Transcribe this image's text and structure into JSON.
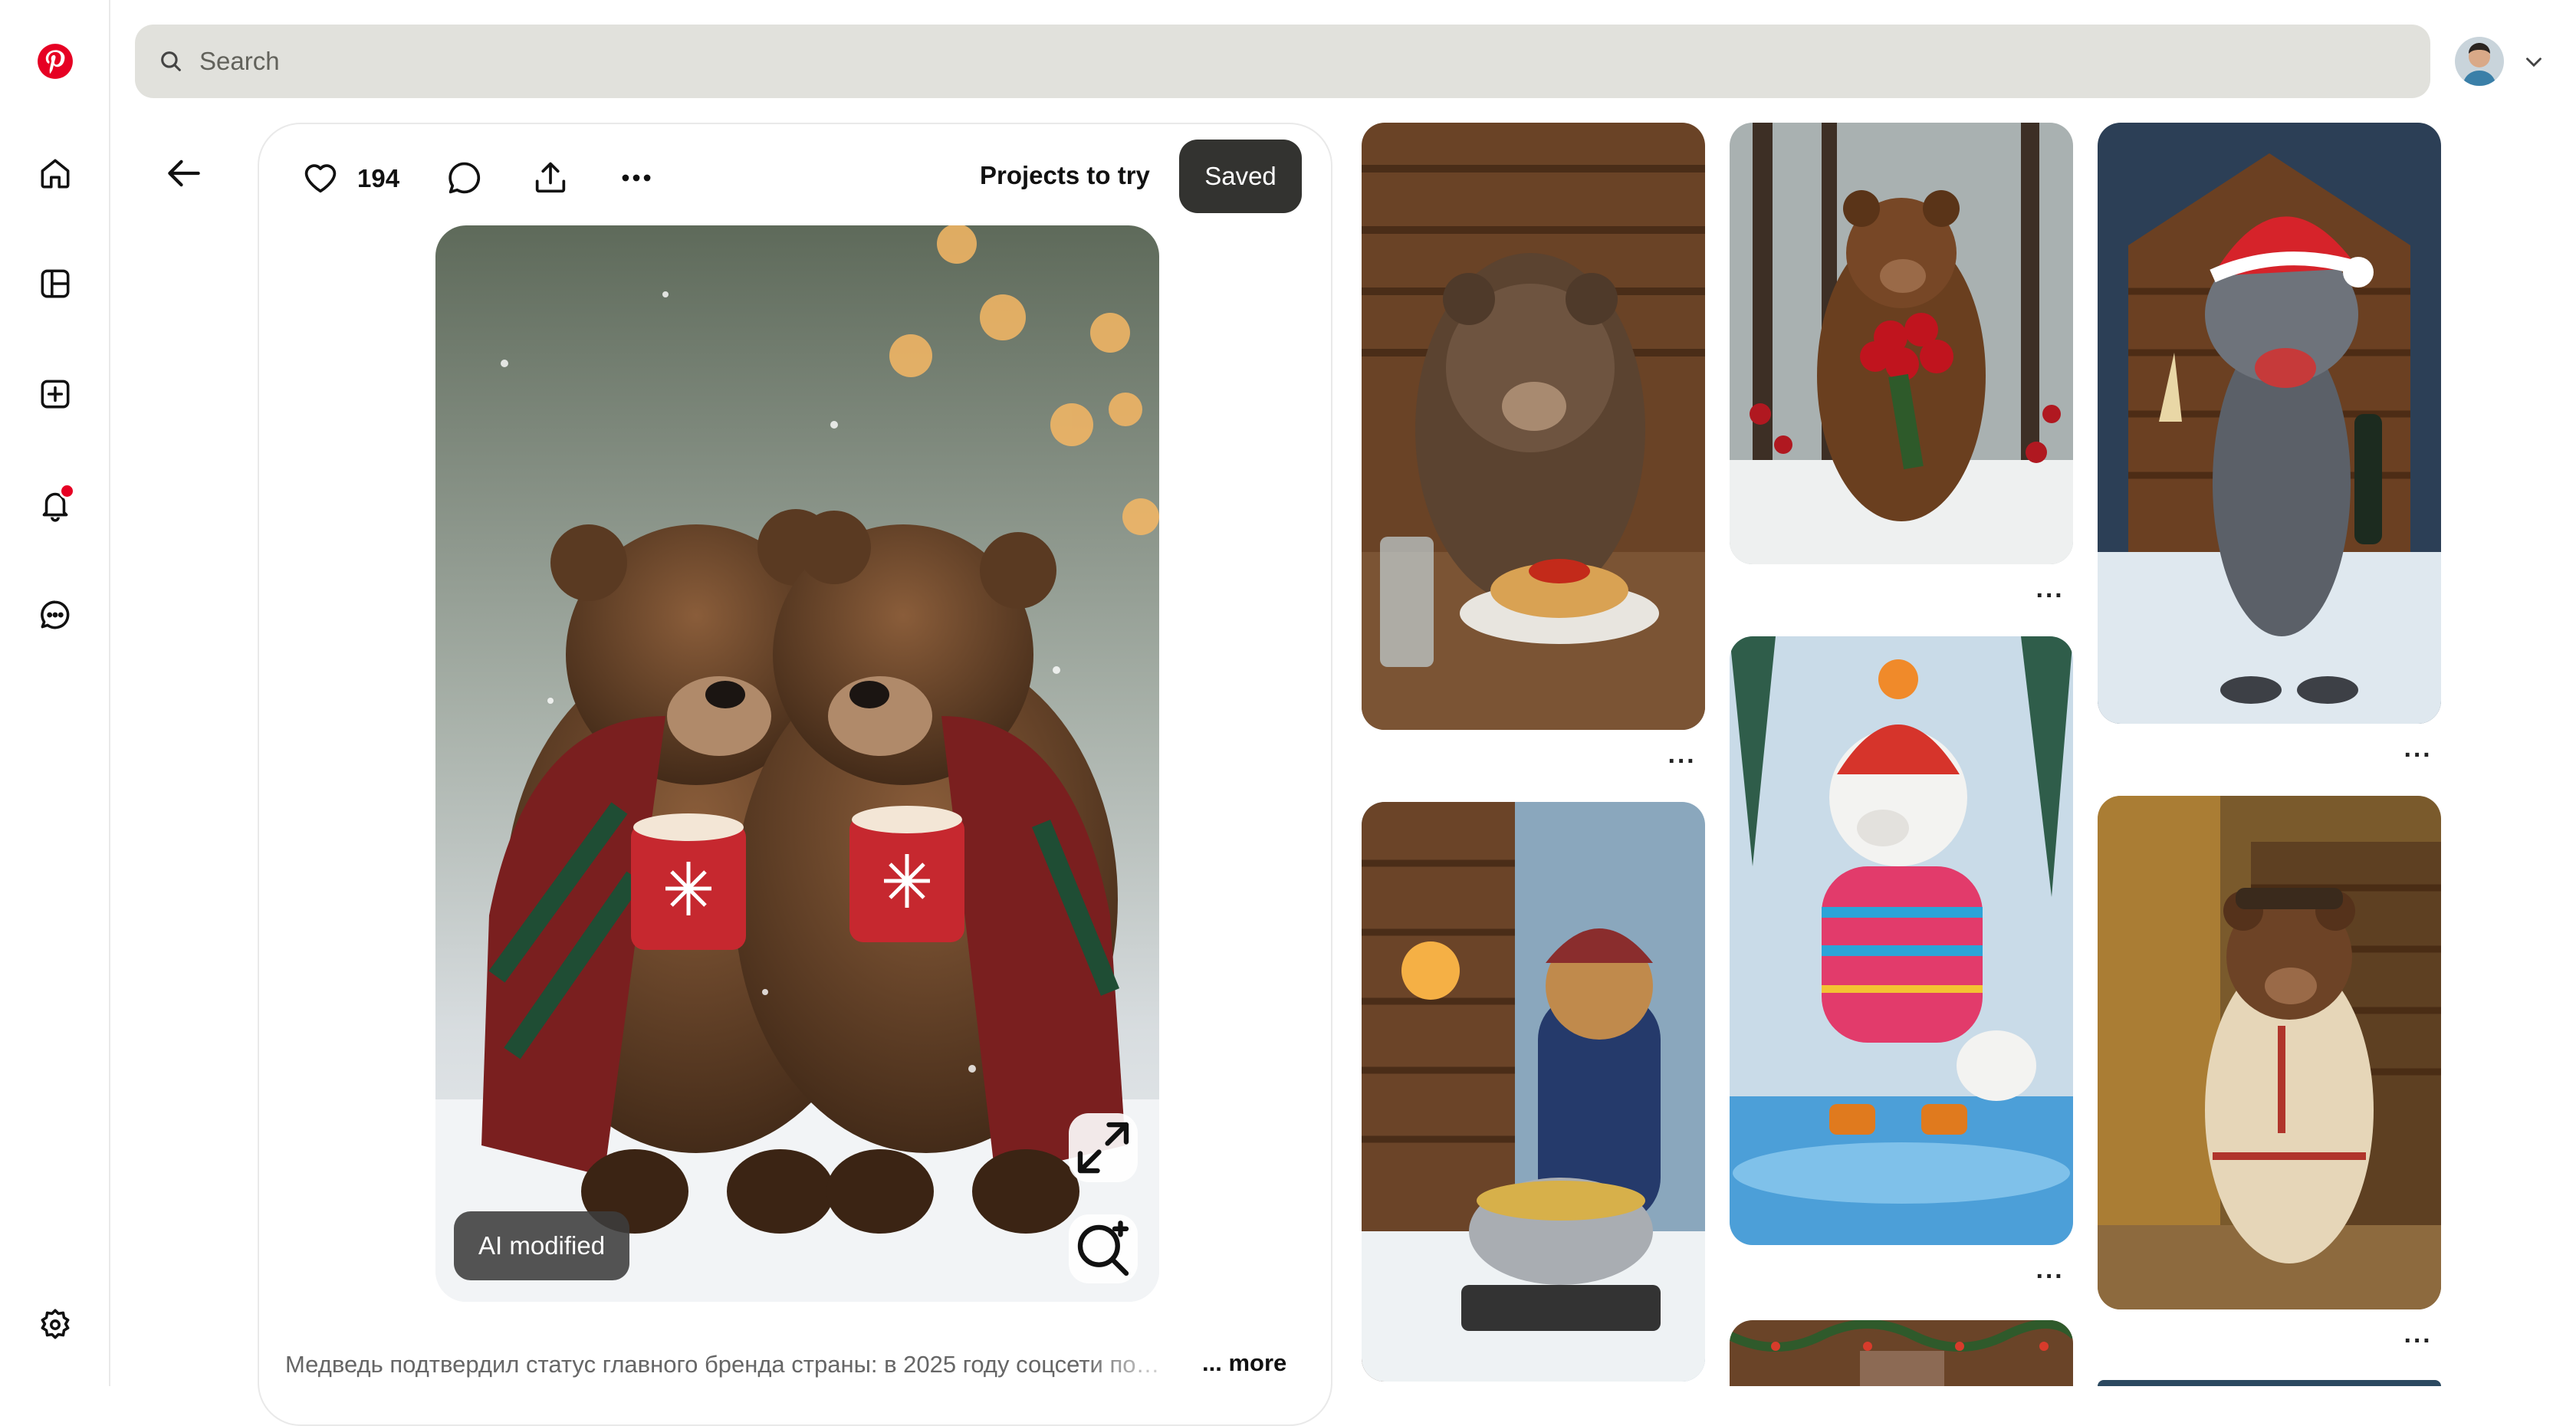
{
  "search": {
    "placeholder": "Search"
  },
  "pin": {
    "like_count": "194",
    "board_name": "Projects to try",
    "save_state_label": "Saved",
    "ai_badge": "AI modified",
    "description": "Медведь подтвердил статус главного бренда страны: в 2025 году соцсети по…",
    "more_label": "... more"
  },
  "icons": {
    "rail": [
      "pinterest-logo-icon",
      "home-icon",
      "explore-icon",
      "create-icon",
      "notifications-icon",
      "messages-icon",
      "settings-icon"
    ],
    "toolbar": [
      "heart-icon",
      "comment-icon",
      "share-icon",
      "more-options-icon"
    ],
    "image": [
      "expand-icon",
      "visual-search-icon"
    ]
  },
  "colors": {
    "brand": "#e60023",
    "saved_button": "#333330",
    "search_bg": "#e1e1dc"
  },
  "grid_pin_more_label": "···"
}
